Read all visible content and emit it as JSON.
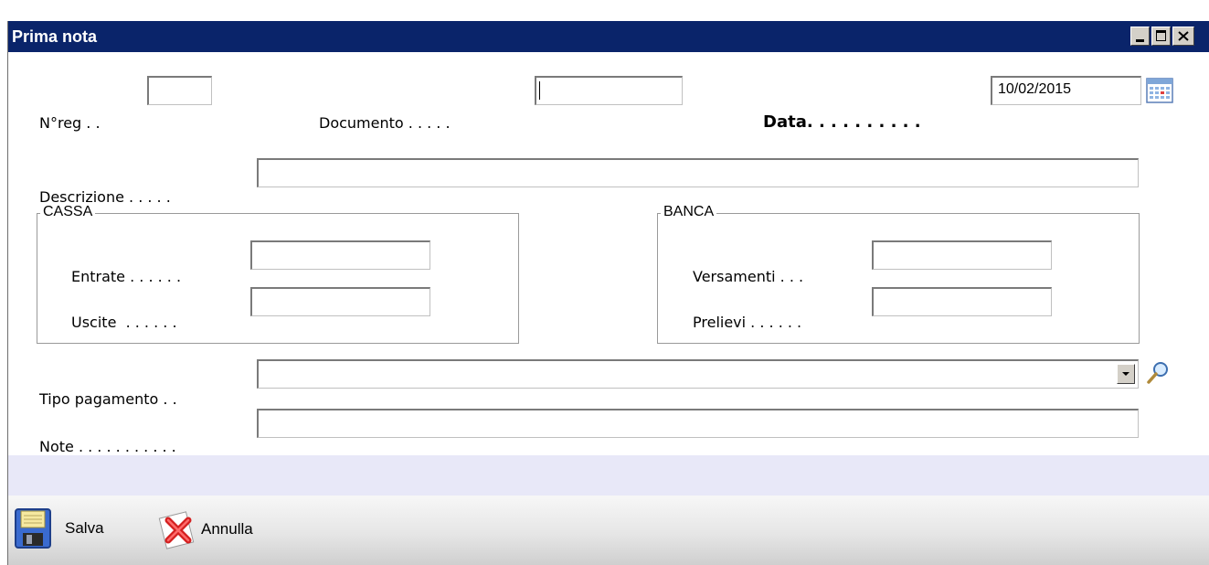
{
  "window": {
    "title": "Prima nota",
    "controls": {
      "minimize": "minimize",
      "maximize": "maximize",
      "close": "close"
    }
  },
  "form": {
    "nreg_label": "N°reg . .",
    "nreg_value": "",
    "documento_label": "Documento . . . . .",
    "documento_value": "",
    "data_label": "Data. . . . . . . . . .",
    "data_value": "10/02/2015",
    "descrizione_label": "Descrizione . . . . .",
    "descrizione_value": "",
    "cassa": {
      "title": "CASSA",
      "entrate_label": "Entrate . . . . . .",
      "entrate_value": "",
      "uscite_label": "Uscite  . . . . . .",
      "uscite_value": ""
    },
    "banca": {
      "title": "BANCA",
      "versamenti_label": "Versamenti . . .",
      "versamenti_value": "",
      "prelievi_label": "Prelievi . . . . . .",
      "prelievi_value": ""
    },
    "tipo_pagamento_label": "Tipo pagamento . .",
    "tipo_pagamento_value": "",
    "note_label": "Note . . . . . . . . . . .",
    "note_value": ""
  },
  "toolbar": {
    "save_label": "Salva",
    "cancel_label": "Annulla"
  },
  "icons": {
    "calendar": "calendar-icon",
    "search": "magnifier-icon",
    "save": "floppy-disk-icon",
    "cancel": "red-x-icon"
  },
  "colors": {
    "titlebar": "#0a246a",
    "status_strip": "#e8e8f8"
  }
}
